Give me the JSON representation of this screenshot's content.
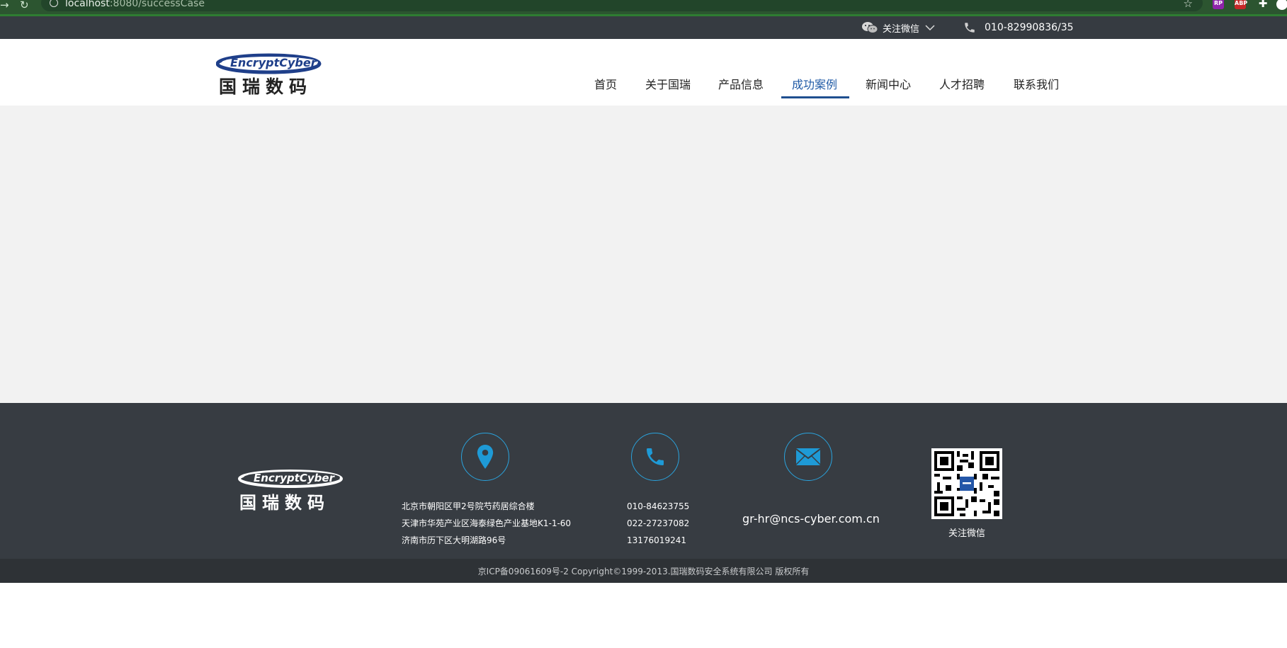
{
  "browser": {
    "url_host": "localhost",
    "url_rest": ":8080/successCase",
    "extensions": [
      "RP",
      "ABP"
    ]
  },
  "topbar": {
    "wechat_label": "关注微信",
    "phone": "010-82990836/35"
  },
  "header": {
    "logo_text_en": "EncryptCyber",
    "logo_text_cn": "国瑞数码",
    "nav": [
      "首页",
      "关于国瑞",
      "产品信息",
      "成功案例",
      "新闻中心",
      "人才招聘",
      "联系我们"
    ],
    "active_index": 3
  },
  "footer": {
    "logo_text_en": "EncryptCyber",
    "logo_text_cn": "国瑞数码",
    "addresses": [
      "北京市朝阳区甲2号院芍药居综合楼",
      "天津市华苑产业区海泰绿色产业基地K1-1-60",
      "济南市历下区大明湖路96号"
    ],
    "phones": [
      "010-84623755",
      "022-27237082",
      "13176019241"
    ],
    "email": "gr-hr@ncs-cyber.com.cn",
    "qr_label": "关注微信",
    "copyright": "京ICP备09061609号-2 Copyright©1999-2013.国瑞数码安全系统有限公司 版权所有"
  },
  "colors": {
    "accent": "#1f5aa6",
    "topbar": "#363b41",
    "footer": "#373c42",
    "footer_bottom": "#2e3236",
    "icon_ring": "#2aa3dd",
    "content_bg": "#f2f2f2"
  }
}
